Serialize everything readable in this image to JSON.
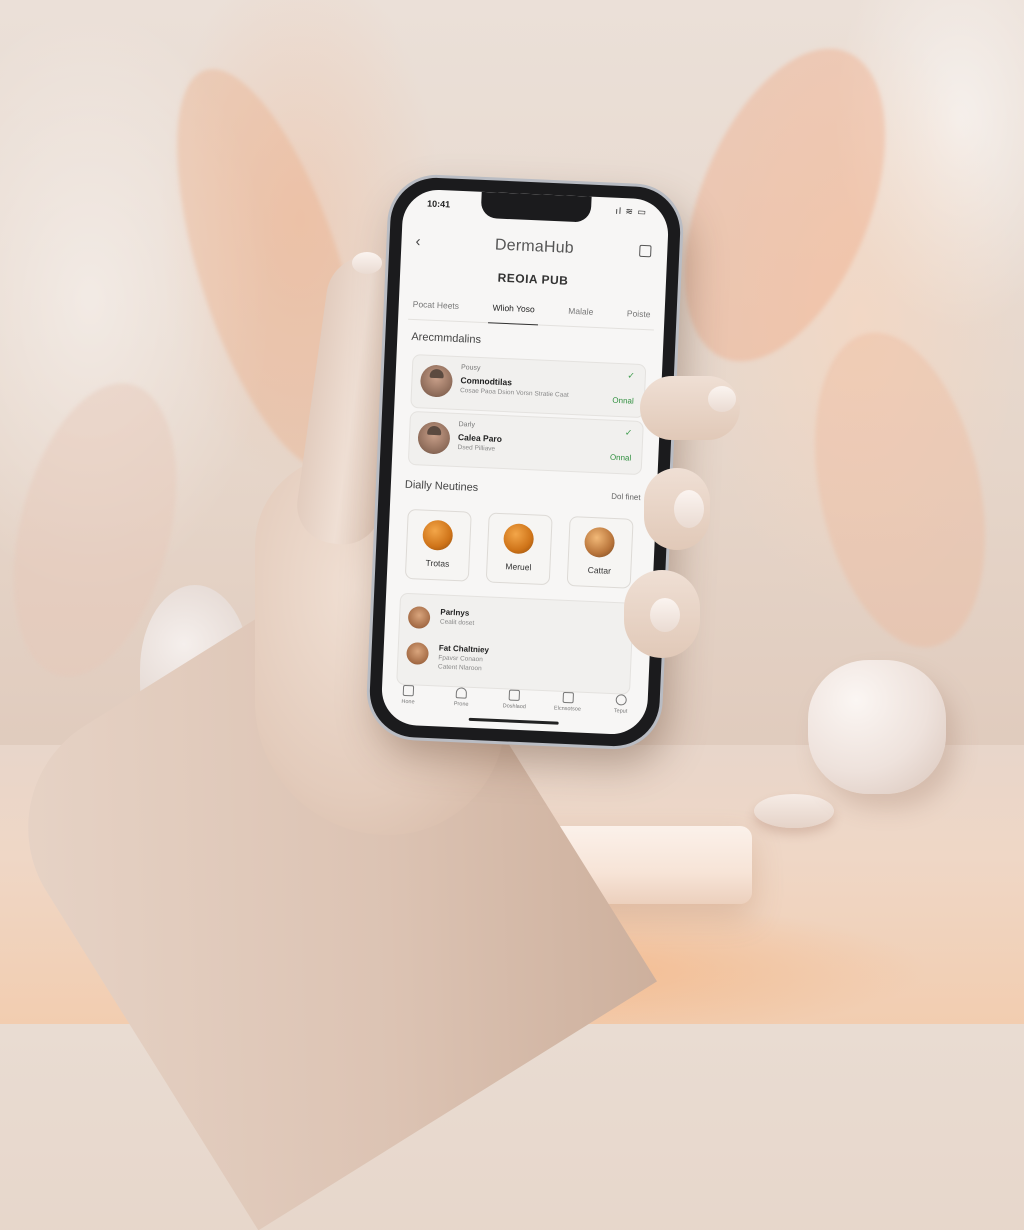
{
  "status_bar": {
    "time": "10:41",
    "icons": "ıl ≋ ▭"
  },
  "header": {
    "back_glyph": "‹",
    "title": "DermaHub",
    "subtitle": "REOIA PUB"
  },
  "tabs": [
    {
      "label": "Pocat Heets",
      "active": false
    },
    {
      "label": "Wlioh Yoso",
      "active": true
    },
    {
      "label": "Malale",
      "active": false
    },
    {
      "label": "Poiste",
      "active": false
    }
  ],
  "recommendations": {
    "title": "Arecmmdalins",
    "items": [
      {
        "top": "Pousy",
        "name": "Comnodtilas",
        "desc": "Cosae Paoa  Dsion Vorsn Stratie Caat",
        "check": "✓",
        "status": "Onnal"
      },
      {
        "top": "Darly",
        "name": "Calea Paro",
        "desc": "Dsed Pilliave",
        "check": "✓",
        "status": "Onnal"
      }
    ]
  },
  "routines": {
    "title": "Dially Neutines",
    "link": "Dol finet",
    "items": [
      {
        "label": "Trotas"
      },
      {
        "label": "Meruel"
      },
      {
        "label": "Cattar"
      }
    ]
  },
  "list": [
    {
      "title": "Parlnys",
      "sub": "Cealit doset",
      "sub2": ""
    },
    {
      "title": "Fat Chaltniey",
      "sub": "Fpavsr Conaon",
      "sub2": "Catent Nlaroon"
    }
  ],
  "bottom_nav": [
    {
      "label": "Hone",
      "icon": "home-icon"
    },
    {
      "label": "Prone",
      "icon": "bell-icon"
    },
    {
      "label": "Doshlaod",
      "icon": "cup-icon"
    },
    {
      "label": "Elcnsotsoe",
      "icon": "camera-icon"
    },
    {
      "label": "Teput",
      "icon": "profile-icon"
    }
  ],
  "colors": {
    "accent_green": "#2f8f3e",
    "routine_orange": "#cf7419",
    "screen_bg": "#f7f6f5"
  }
}
